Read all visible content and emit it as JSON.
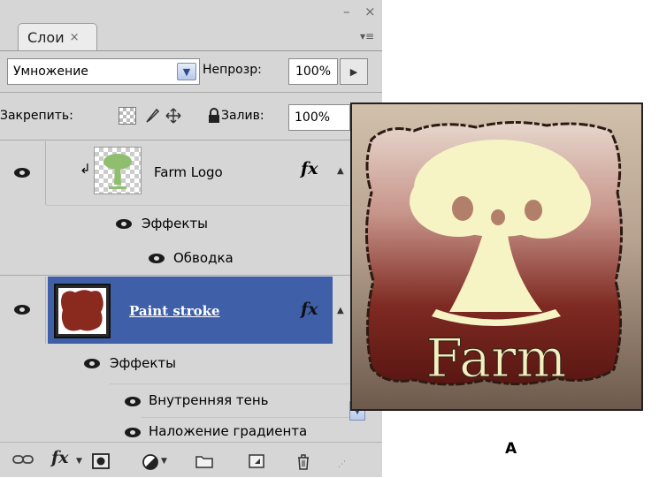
{
  "panel": {
    "tab_title": "Слои",
    "tab_close": "×",
    "window_minimize": "–",
    "window_close": "×",
    "menu_icon": "▾≡"
  },
  "blend": {
    "mode": "Умножение",
    "opacity_label": "Непрозр:",
    "opacity_value": "100%"
  },
  "lock": {
    "label": "Закрепить:",
    "fill_label": "Залив:",
    "fill_value": "100%"
  },
  "layers": [
    {
      "name": "Farm Logo",
      "fx": "fx",
      "selected": false,
      "effects_label": "Эффекты",
      "effects": [
        "Обводка"
      ]
    },
    {
      "name": "Paint stroke",
      "fx": "fx",
      "selected": true,
      "effects_label": "Эффекты",
      "effects": [
        "Внутренняя тень",
        "Наложение градиента"
      ]
    }
  ],
  "toolbar": {
    "link_icon": "link-icon",
    "fx_label": "fx"
  },
  "artwork": {
    "text": "Farm",
    "colors": {
      "background_top": "#c8b8a6",
      "background_bottom": "#6e5a4c",
      "stroke": "#6b1f1a",
      "tree": "#f6f4c4",
      "text": "#f3efc0"
    }
  },
  "caption": "A",
  "colors": {
    "panel_bg": "#d6d6d6",
    "selected_row": "#3f5fa8",
    "thumb_red": "#8a2a1f"
  }
}
